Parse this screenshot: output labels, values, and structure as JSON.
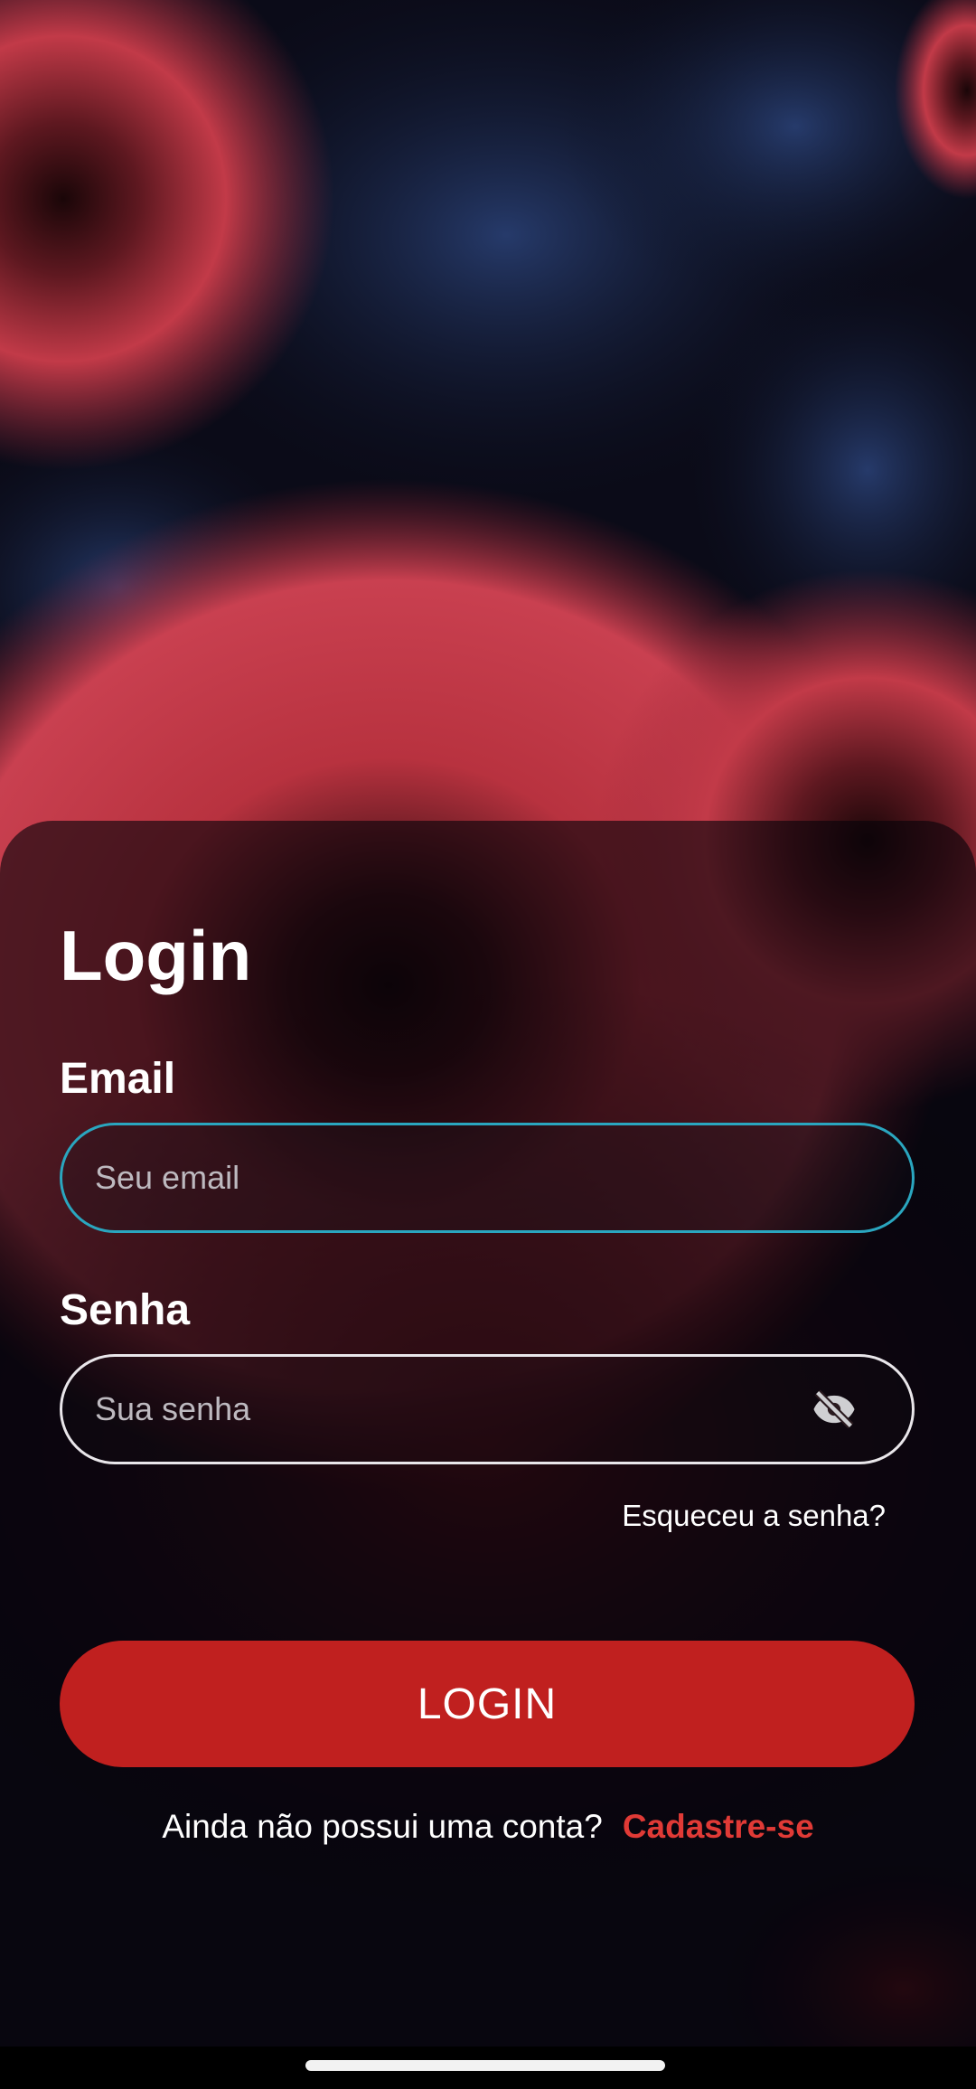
{
  "login": {
    "title": "Login",
    "email_label": "Email",
    "email_placeholder": "Seu email",
    "password_label": "Senha",
    "password_placeholder": "Sua senha",
    "password_toggle_icon": "eye-off-icon",
    "forgot_password": "Esqueceu a senha?",
    "login_button": "LOGIN",
    "signup_prompt": "Ainda não possui uma conta?",
    "signup_link": "Cadastre-se"
  },
  "colors": {
    "primary": "#c0201f",
    "link": "#e03a36",
    "focus_border": "#2aa6bf",
    "text": "#ffffff"
  }
}
